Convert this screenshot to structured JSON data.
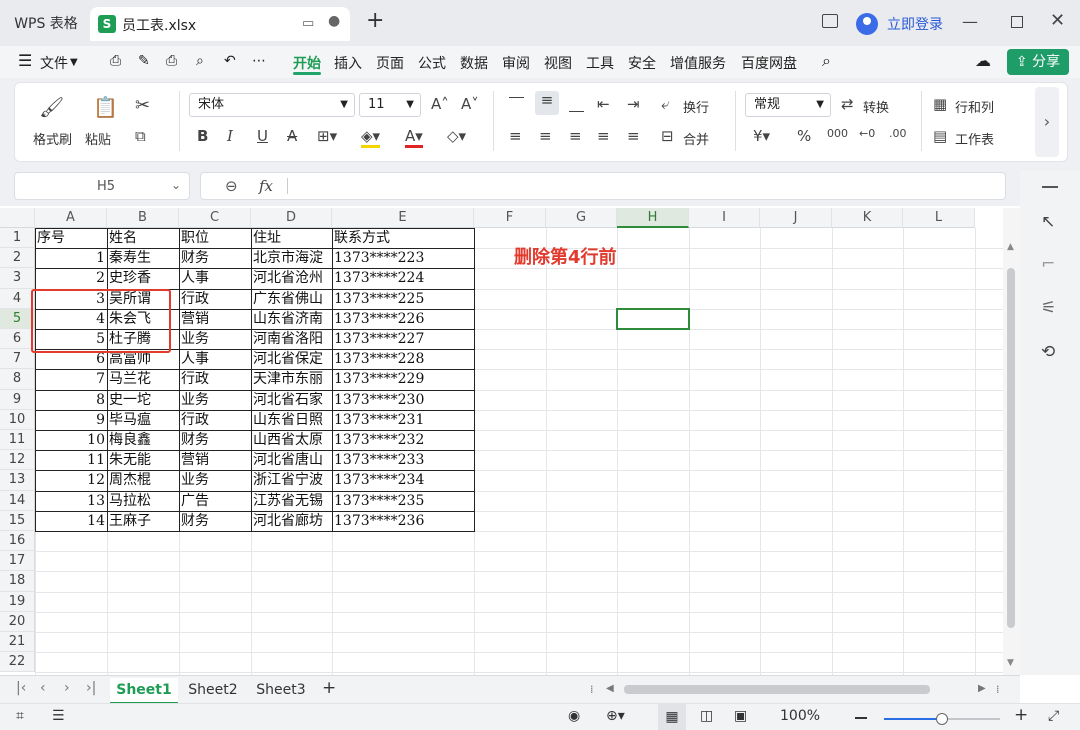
{
  "titlebar": {
    "app_label": "WPS 表格",
    "file_name": "员工表.xlsx",
    "file_icon_letter": "S",
    "new_tab": "+",
    "login": "立即登录"
  },
  "menu": {
    "items": [
      "文件",
      "开始",
      "插入",
      "页面",
      "公式",
      "数据",
      "审阅",
      "视图",
      "工具",
      "安全",
      "增值服务",
      "百度网盘"
    ],
    "active": "开始",
    "share": "分享"
  },
  "ribbon": {
    "format_painter": "格式刷",
    "paste": "粘贴",
    "font_name": "宋体",
    "font_size": "11",
    "wrap": "换行",
    "merge": "合并",
    "number_format": "常规",
    "convert": "转换",
    "row_col": "行和列",
    "worksheet": "工作表",
    "bold": "B",
    "italic": "I",
    "underline": "U",
    "strike": "A"
  },
  "formula_bar": {
    "name_box": "H5",
    "fx": "fx",
    "zoom_icon": "⊖",
    "value": ""
  },
  "sheet": {
    "columns": [
      "A",
      "B",
      "C",
      "D",
      "E",
      "F",
      "G",
      "H",
      "I",
      "J",
      "K",
      "L"
    ],
    "active_column": "H",
    "row_numbers": [
      "1",
      "2",
      "3",
      "4",
      "5",
      "6",
      "7",
      "8",
      "9",
      "10",
      "11",
      "12",
      "13",
      "14",
      "15",
      "16",
      "17",
      "18",
      "19",
      "20",
      "21",
      "22"
    ],
    "header": [
      "序号",
      "姓名",
      "职位",
      "住址",
      "联系方式"
    ],
    "rows": [
      [
        "1",
        "秦寿生",
        "财务",
        "北京市海淀",
        "1373****223"
      ],
      [
        "2",
        "史珍香",
        "人事",
        "河北省沧州",
        "1373****224"
      ],
      [
        "3",
        "吴所谓",
        "行政",
        "广东省佛山",
        "1373****225"
      ],
      [
        "4",
        "朱会飞",
        "营销",
        "山东省济南",
        "1373****226"
      ],
      [
        "5",
        "杜子腾",
        "业务",
        "河南省洛阳",
        "1373****227"
      ],
      [
        "6",
        "高富帅",
        "人事",
        "河北省保定",
        "1373****228"
      ],
      [
        "7",
        "马兰花",
        "行政",
        "天津市东丽",
        "1373****229"
      ],
      [
        "8",
        "史一坨",
        "业务",
        "河北省石家",
        "1373****230"
      ],
      [
        "9",
        "毕马瘟",
        "行政",
        "山东省日照",
        "1373****231"
      ],
      [
        "10",
        "梅良鑫",
        "财务",
        "山西省太原",
        "1373****232"
      ],
      [
        "11",
        "朱无能",
        "营销",
        "河北省唐山",
        "1373****233"
      ],
      [
        "12",
        "周杰棍",
        "业务",
        "浙江省宁波",
        "1373****234"
      ],
      [
        "13",
        "马拉松",
        "广告",
        "江苏省无锡",
        "1373****235"
      ],
      [
        "14",
        "王麻子",
        "财务",
        "河北省廊坊",
        "1373****236"
      ]
    ],
    "annotation": "删除第4行前",
    "annotation_color": "#e23b2e",
    "selected_cell": "H5"
  },
  "sheet_tabs": [
    "Sheet1",
    "Sheet2",
    "Sheet3"
  ],
  "active_sheet": "Sheet1",
  "status": {
    "zoom": "100%",
    "zoom_fraction": 0.5
  },
  "colors": {
    "accent_green": "#1f9d55",
    "share_green": "#1f9d68",
    "login_blue": "#2a5bd7",
    "highlight_red": "#e23b2e"
  }
}
